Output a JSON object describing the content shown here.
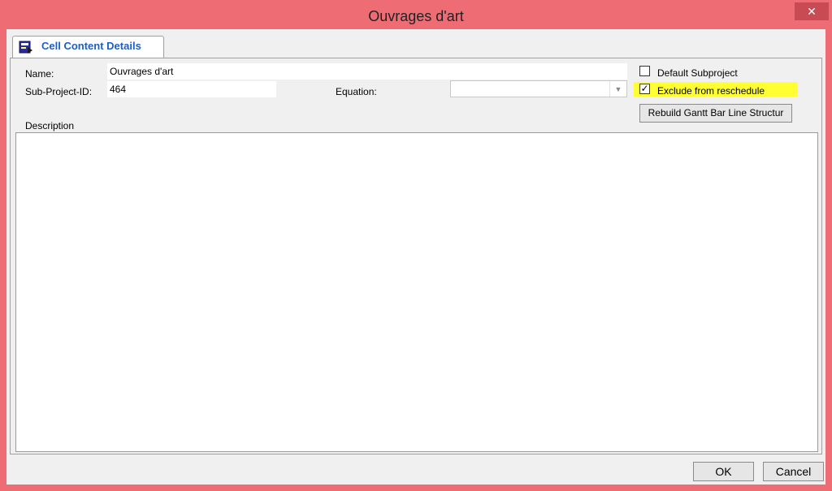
{
  "window": {
    "title": "Ouvrages d'art",
    "close_glyph": "✕"
  },
  "tab": {
    "label": "Cell Content Details",
    "icon": "cell-details-icon"
  },
  "form": {
    "name_label": "Name:",
    "name_value": "Ouvrages d'art",
    "subproject_id_label": "Sub-Project-ID:",
    "subproject_id_value": "464",
    "equation_label": "Equation:",
    "equation_value": "",
    "default_subproject_label": "Default Subproject",
    "default_subproject_checked": false,
    "exclude_label": "Exclude from reschedule",
    "exclude_checked": true,
    "rebuild_button": "Rebuild Gantt Bar Line Structur",
    "description_label": "Description",
    "description_value": ""
  },
  "footer": {
    "ok": "OK",
    "cancel": "Cancel"
  },
  "colors": {
    "frame": "#ee6d75",
    "tab_text": "#1a5fc8",
    "highlight": "#ffff33"
  }
}
